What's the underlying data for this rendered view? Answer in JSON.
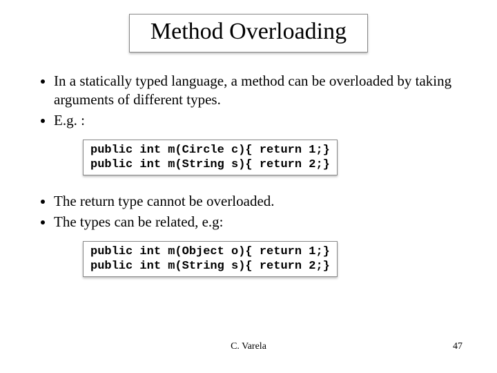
{
  "title": "Method Overloading",
  "bullets_a": [
    "In a statically typed language, a method can be overloaded by taking arguments of different types.",
    "E.g. :"
  ],
  "code_a": "public int m(Circle c){ return 1;}\npublic int m(String s){ return 2;}",
  "bullets_b": [
    "The return type cannot be overloaded.",
    "The types can be related, e.g:"
  ],
  "code_b": "public int m(Object o){ return 1;}\npublic int m(String s){ return 2;}",
  "footer_author": "C. Varela",
  "footer_page": "47"
}
